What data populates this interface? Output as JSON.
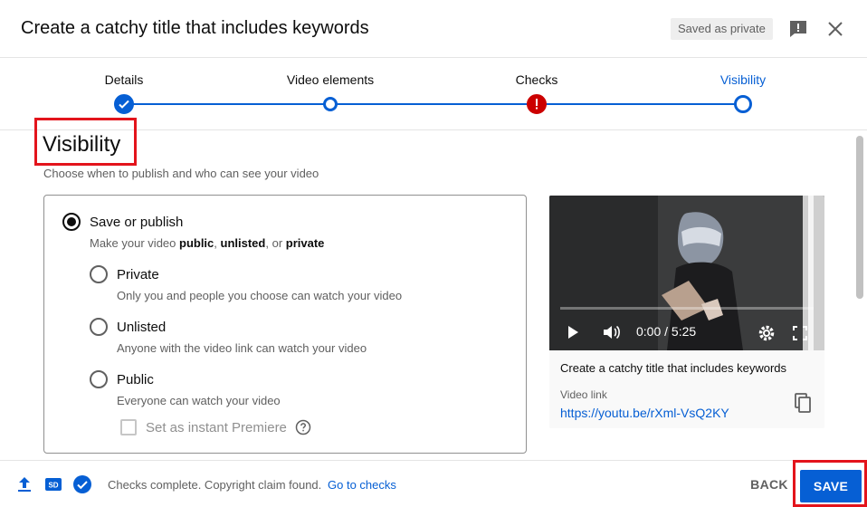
{
  "header": {
    "title": "Create a catchy title that includes keywords",
    "saved_badge": "Saved as private",
    "icons": {
      "feedback": "feedback-icon",
      "close": "close-icon"
    }
  },
  "stepper": {
    "steps": [
      {
        "label": "Details",
        "state": "done"
      },
      {
        "label": "Video elements",
        "state": "open"
      },
      {
        "label": "Checks",
        "state": "error"
      },
      {
        "label": "Visibility",
        "state": "active"
      }
    ]
  },
  "visibility": {
    "heading": "Visibility",
    "subtitle": "Choose when to publish and who can see your video",
    "save_or_publish": {
      "title": "Save or publish",
      "desc_prefix": "Make your video ",
      "desc_public": "public",
      "desc_sep1": ", ",
      "desc_unlisted": "unlisted",
      "desc_sep2": ", or ",
      "desc_private": "private",
      "selected": true
    },
    "options": [
      {
        "title": "Private",
        "desc": "Only you and people you choose can watch your video",
        "selected": false
      },
      {
        "title": "Unlisted",
        "desc": "Anyone with the video link can watch your video",
        "selected": false
      },
      {
        "title": "Public",
        "desc": "Everyone can watch your video",
        "selected": false
      }
    ],
    "premiere": {
      "label": "Set as instant Premiere",
      "checked": false,
      "disabled": true
    }
  },
  "video_card": {
    "time": "0:00 / 5:25",
    "title": "Create a catchy title that includes keywords",
    "link_label": "Video link",
    "link": "https://youtu.be/rXml-VsQ2KY"
  },
  "footer": {
    "status": "Checks complete. Copyright claim found.",
    "link": "Go to checks",
    "back_label": "BACK",
    "save_label": "SAVE"
  },
  "colors": {
    "accent": "#065fd4",
    "error": "#cc0000",
    "highlight": "#e3141c"
  }
}
